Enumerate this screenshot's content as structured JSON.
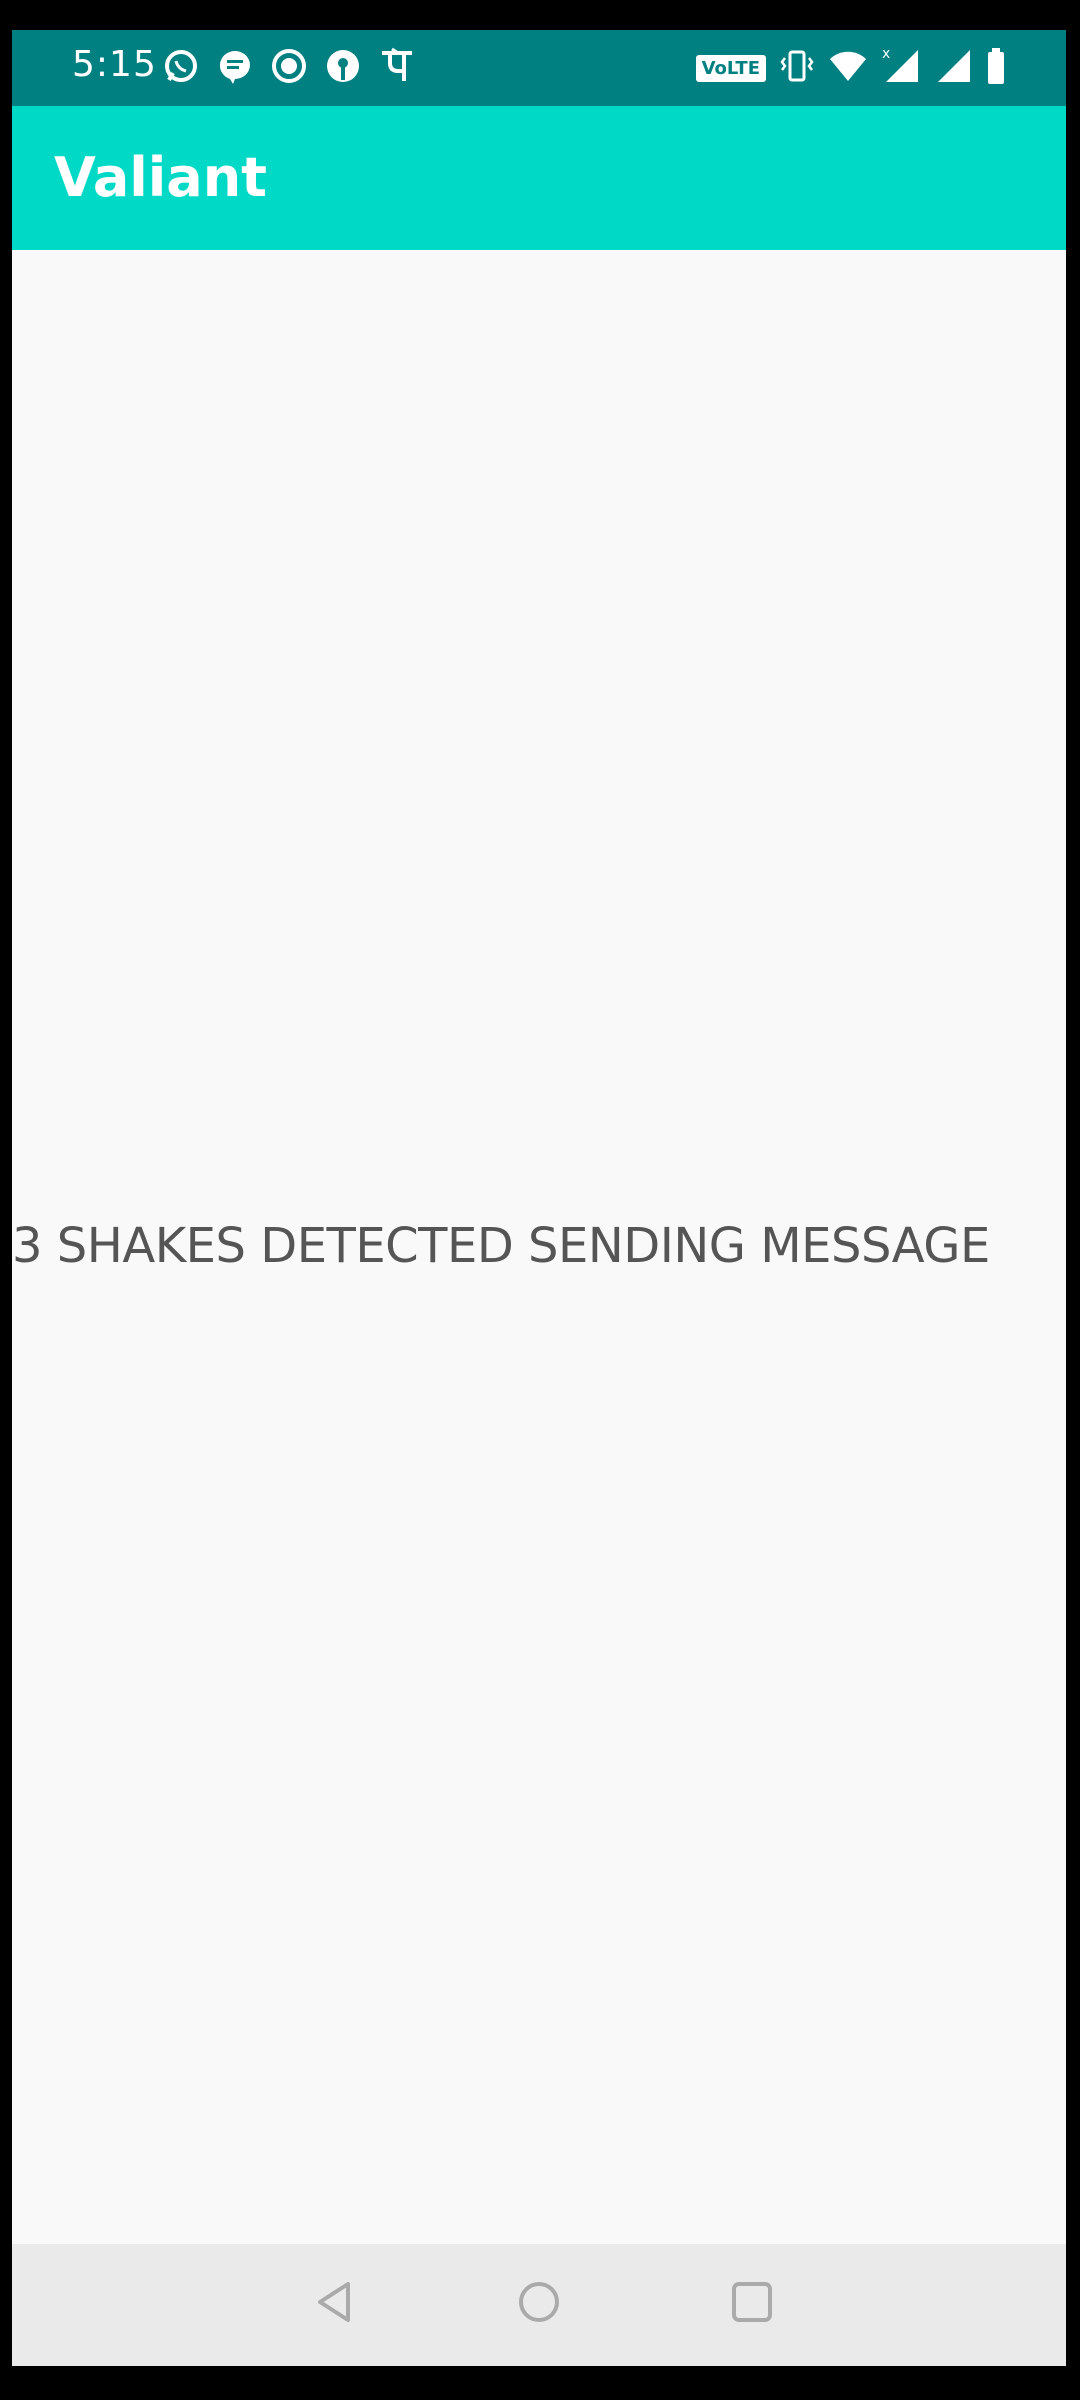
{
  "status_bar": {
    "time": "5:15",
    "left_icons": [
      "whatsapp-icon",
      "chat-bubble-icon",
      "record-icon",
      "bank-icon",
      "phonepe-icon"
    ],
    "volte_label": "VoLTE",
    "right_icons": [
      "vibrate-icon",
      "wifi-icon",
      "signal-x-icon",
      "signal-icon",
      "battery-icon"
    ],
    "background_color": "#008080"
  },
  "app_bar": {
    "title": "Valiant",
    "background_color": "#00d9c6"
  },
  "content": {
    "message": "3 SHAKES DETECTED SENDING MESSAGE"
  },
  "nav_bar": {
    "buttons": [
      "back-icon",
      "home-icon",
      "recents-icon"
    ]
  }
}
